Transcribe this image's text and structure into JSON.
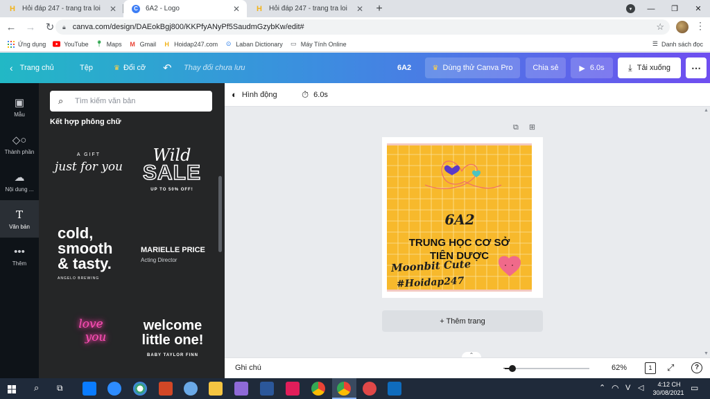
{
  "browser": {
    "tabs": [
      {
        "title": "Hỏi đáp 247 - trang tra loi",
        "icon": "h-icon",
        "active": false
      },
      {
        "title": "6A2 - Logo",
        "icon": "canva-icon",
        "active": true
      },
      {
        "title": "Hỏi đáp 247 - trang tra loi",
        "icon": "h-icon",
        "active": false
      }
    ],
    "url": "canva.com/design/DAEokBgj800/KKPfyANyPf5SaudmGzybKw/edit#",
    "bookmarks": [
      {
        "label": "Ứng dụng",
        "icon": "apps-icon"
      },
      {
        "label": "YouTube",
        "icon": "youtube-icon"
      },
      {
        "label": "Maps",
        "icon": "maps-icon"
      },
      {
        "label": "Gmail",
        "icon": "gmail-icon"
      },
      {
        "label": "Hoidap247.com",
        "icon": "h-icon"
      },
      {
        "label": "Laban Dictionary",
        "icon": "laban-icon"
      },
      {
        "label": "Máy Tính Online",
        "icon": "calculator-icon"
      }
    ],
    "reading_list": "Danh sách đọc"
  },
  "header": {
    "home": "Trang chủ",
    "file": "Tệp",
    "resize": "Đổi cỡ",
    "save_status": "Thay đổi chưa lưu",
    "doc_title": "6A2",
    "pro": "Dùng thử Canva Pro",
    "share": "Chia sẻ",
    "play": "6.0s",
    "download": "Tải xuống"
  },
  "rail": [
    {
      "label": "Mẫu",
      "icon": "template-icon"
    },
    {
      "label": "Thành phần",
      "icon": "elements-icon"
    },
    {
      "label": "Nội dung ...",
      "icon": "upload-icon"
    },
    {
      "label": "Văn bản",
      "icon": "text-icon"
    },
    {
      "label": "Thêm",
      "icon": "more-icon"
    }
  ],
  "panel": {
    "search_placeholder": "Tìm kiếm văn bản",
    "title": "Kết hợp phông chữ",
    "presets": {
      "gift_top": "A GIFT",
      "gift_main": "just for you",
      "wild": "Wild",
      "sale": "SALE",
      "sale_sub": "UP TO 50% OFF!",
      "cold": "cold,",
      "smooth": "smooth",
      "tasty": "& tasty.",
      "cold_sub": "ANGELO BREWING",
      "name": "MARIELLE PRICE",
      "role": "Acting Director",
      "love": "love",
      "you": "you",
      "welcome": "welcome",
      "little": "little one!",
      "baby": "BABY TAYLOR FINN"
    }
  },
  "editor": {
    "animate": "Hình động",
    "duration": "6.0s",
    "add_page": "+ Thêm trang",
    "design": {
      "code": "6A2",
      "line1": "TRUNG HỌC CƠ SỞ",
      "line2": "TIÊN DƯỢC",
      "script": "Moonbit Cute",
      "hashtag": "#Hoidap247",
      "background": "#f7b92c"
    }
  },
  "bottom": {
    "notes": "Ghi chú",
    "zoom": "62%",
    "zoom_fraction": 0.09,
    "page_count": "1"
  },
  "taskbar": {
    "lang": "V",
    "time": "4:12 CH",
    "date": "30/08/2021"
  }
}
